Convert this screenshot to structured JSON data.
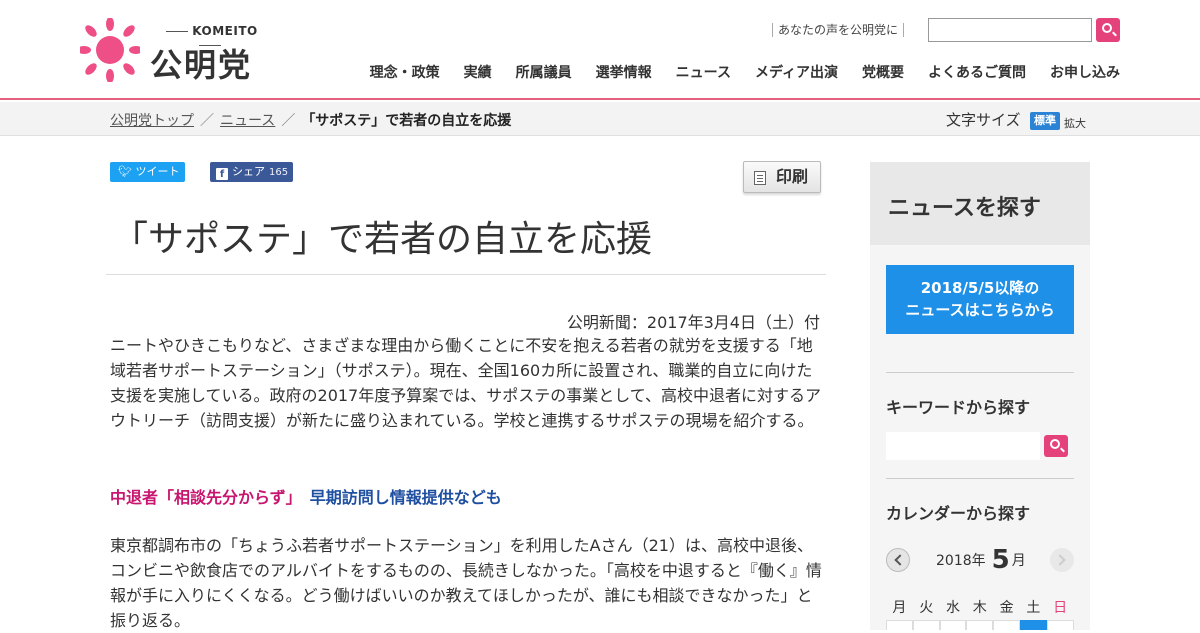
{
  "logo": {
    "english": "KOMEITO",
    "japanese": "公明党"
  },
  "header": {
    "voice_link": "あなたの声を公明党に",
    "search_placeholder": "",
    "nav": [
      "理念・政策",
      "実績",
      "所属議員",
      "選挙情報",
      "ニュース",
      "メディア出演",
      "党概要",
      "よくあるご質問",
      "お申し込み"
    ]
  },
  "breadcrumb": {
    "home": "公明党トップ",
    "news": "ニュース",
    "current": "「サポステ」で若者の自立を応援",
    "separator": "／"
  },
  "font_size": {
    "label": "文字サイズ",
    "standard": "標準",
    "large": "拡大"
  },
  "social": {
    "tweet": "ツイート",
    "share": "シェア",
    "share_count": "165"
  },
  "print": {
    "label": "印刷"
  },
  "article": {
    "title": "「サポステ」で若者の自立を応援",
    "pubdate": "公明新聞：2017年3月4日（土）付",
    "lead": "ニートやひきこもりなど、さまざまな理由から働くことに不安を抱える若者の就労を支援する「地域若者サポートステーション」（サポステ）。現在、全国160カ所に設置され、職業的自立に向けた支援を実施している。政府の2017年度予算案では、サポステの事業として、高校中退者に対するアウトリーチ（訪問支援）が新たに盛り込まれている。学校と連携するサポステの現場を紹介する。",
    "subhead_pink": "中退者「相談先分からず」",
    "subhead_blue": "早期訪問し情報提供なども",
    "body": "東京都調布市の「ちょうふ若者サポートステーション」を利用したAさん（21）は、高校中退後、コンビニや飲食店でのアルバイトをするものの、長続きしなかった。「高校を中退すると『働く』情報が手に入りにくくなる。どう働けばいいのか教えてほしかったが、誰にも相談できなかった」と振り返る。"
  },
  "sidebar": {
    "title": "ニュースを探す",
    "banner_line1": "2018/5/5以降の",
    "banner_line2": "ニュースはこちらから",
    "keyword_label": "キーワードから探す",
    "calendar_label": "カレンダーから探す",
    "calendar": {
      "year": "2018年",
      "month": "5",
      "month_unit": "月",
      "weekdays": [
        "月",
        "火",
        "水",
        "木",
        "金",
        "土",
        "日"
      ]
    }
  },
  "colors": {
    "accent_pink": "#e5417a",
    "header_rule": "#e5627f",
    "banner_blue": "#1e90e8",
    "twitter": "#1da1f2",
    "facebook": "#3b5998"
  }
}
